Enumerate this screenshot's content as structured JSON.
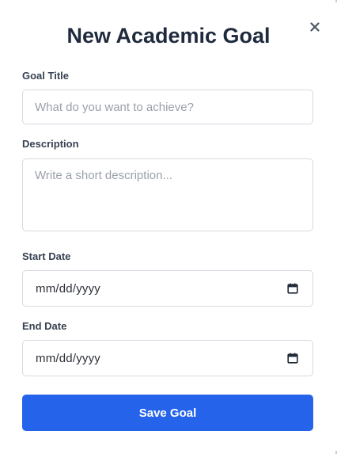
{
  "modal": {
    "title": "New Academic Goal",
    "close_icon": "close-icon"
  },
  "form": {
    "goal_title": {
      "label": "Goal Title",
      "value": "",
      "placeholder": "What do you want to achieve?"
    },
    "description": {
      "label": "Description",
      "value": "",
      "placeholder": "Write a short description..."
    },
    "start_date": {
      "label": "Start Date",
      "value": "mm/dd/yyyy",
      "icon": "calendar-icon"
    },
    "end_date": {
      "label": "End Date",
      "value": "mm/dd/yyyy",
      "icon": "calendar-icon"
    },
    "submit_label": "Save Goal"
  },
  "colors": {
    "primary": "#2563eb",
    "title": "#1f2a3d",
    "label": "#374151",
    "border": "#d6dae1",
    "placeholder": "#9aa0a9"
  }
}
